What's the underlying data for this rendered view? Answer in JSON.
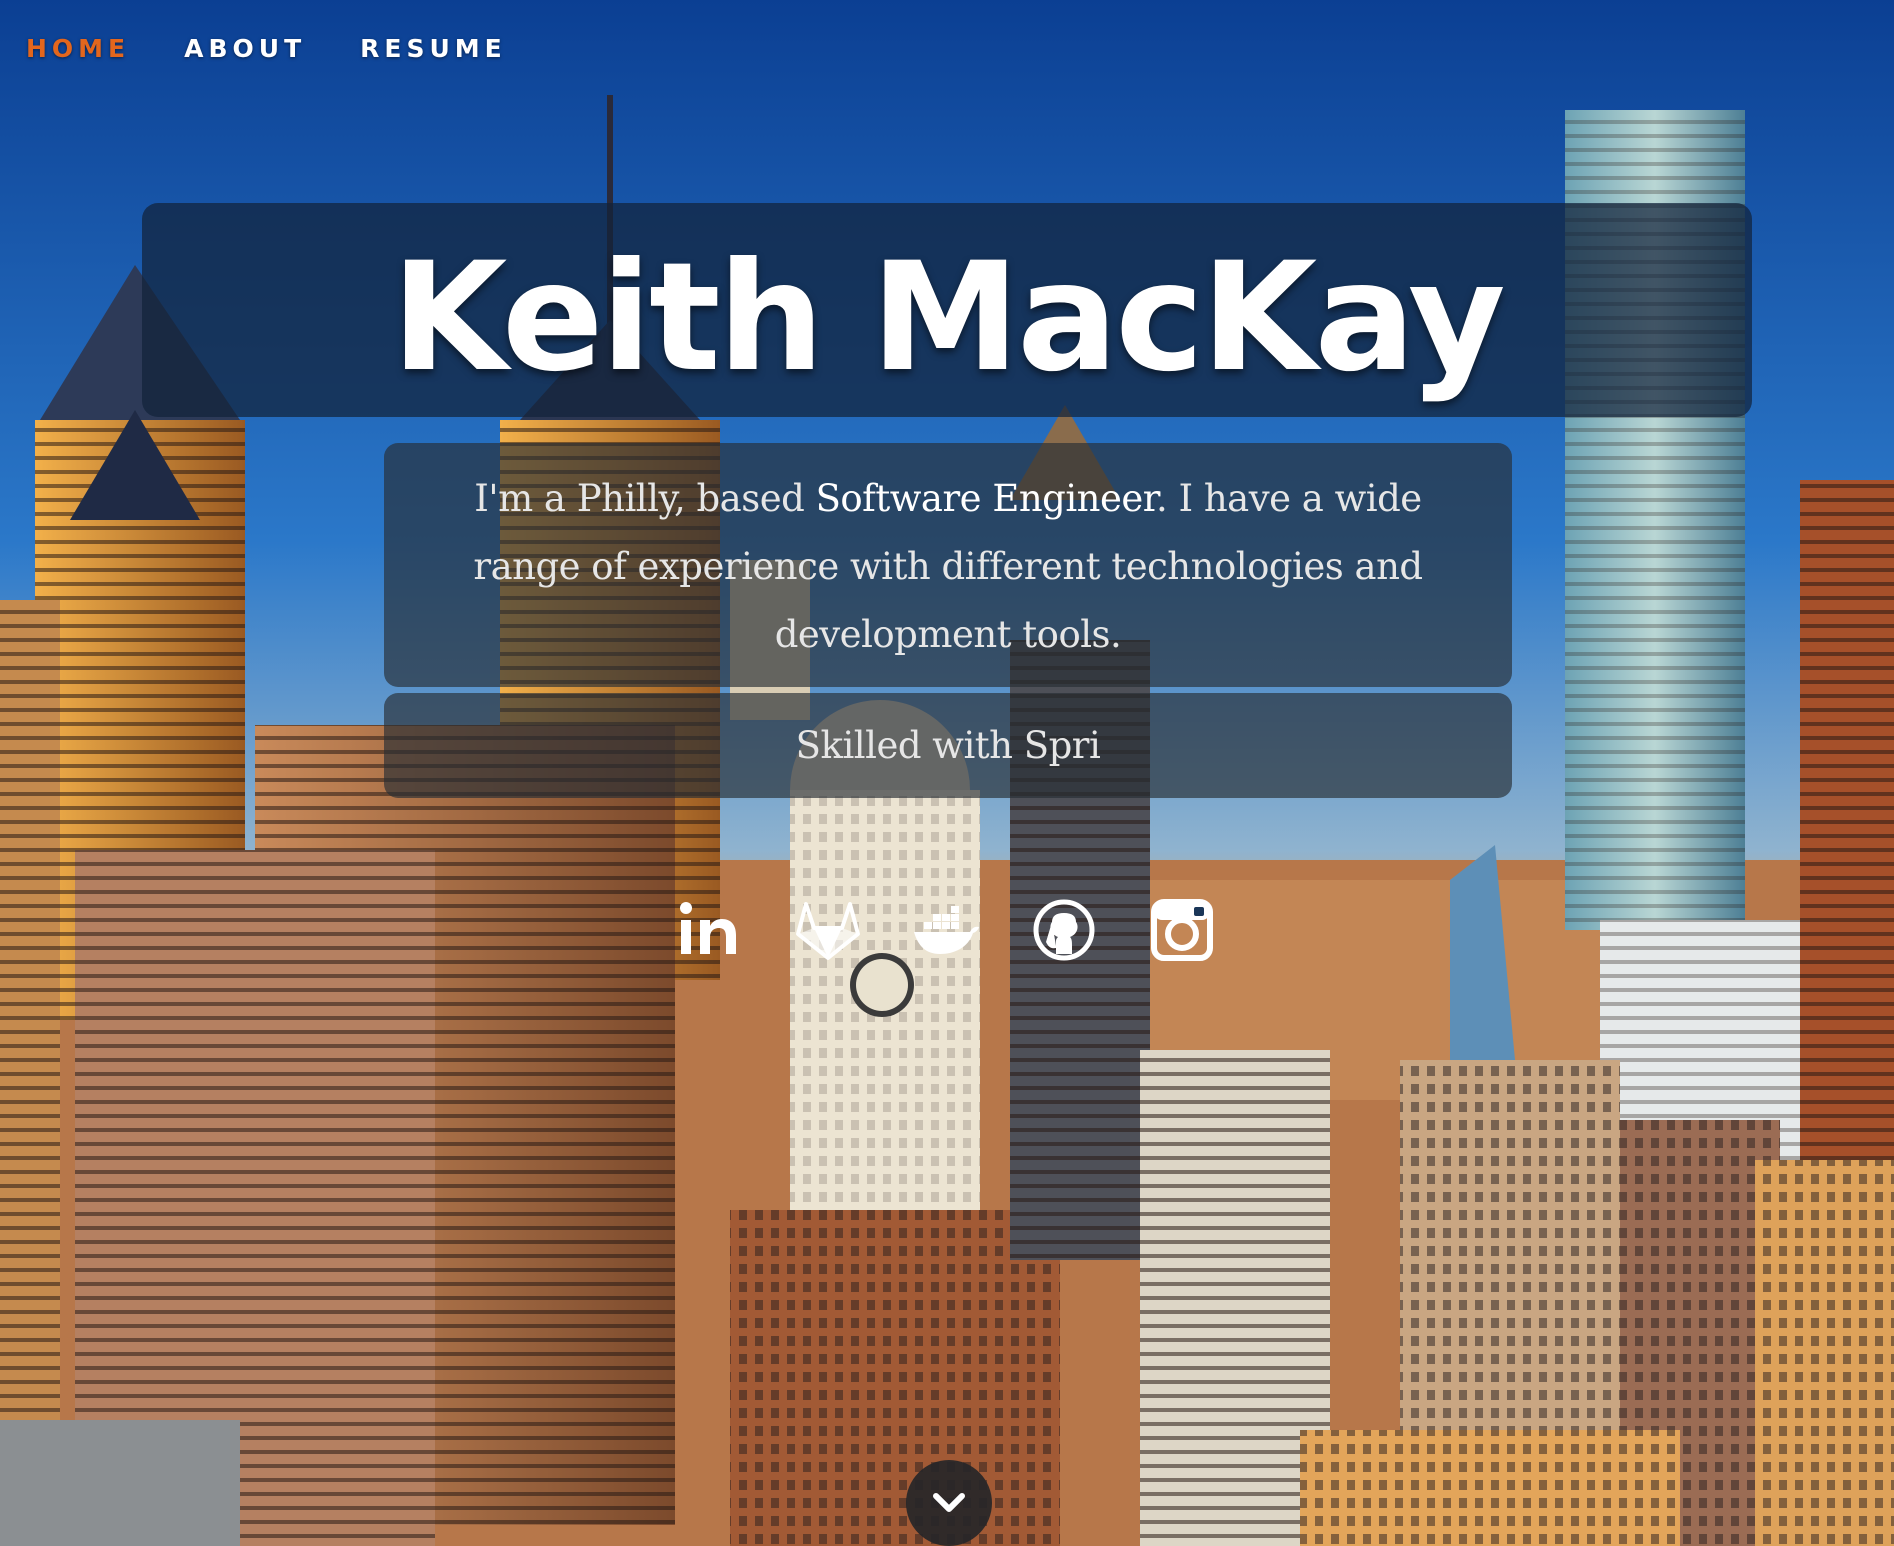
{
  "nav": {
    "items": [
      {
        "label": "HOME",
        "active": true
      },
      {
        "label": "ABOUT",
        "active": false
      },
      {
        "label": "RESUME",
        "active": false
      }
    ]
  },
  "hero": {
    "name": "Keith MacKay",
    "bio_before": "I'm a Philly, based ",
    "bio_strong": "Software Engineer",
    "bio_after": ". I have a wide range of experience with different technologies and development tools.",
    "skill_text": "Skilled with Spri"
  },
  "social": [
    {
      "icon": "linkedin-icon"
    },
    {
      "icon": "gitlab-icon"
    },
    {
      "icon": "docker-icon"
    },
    {
      "icon": "github-icon"
    },
    {
      "icon": "instagram-icon"
    }
  ],
  "colors": {
    "nav_active": "#e3661d",
    "nav_text": "#ffffff",
    "panel_bg": "#12223a",
    "sky_top": "#0d4aa0"
  }
}
